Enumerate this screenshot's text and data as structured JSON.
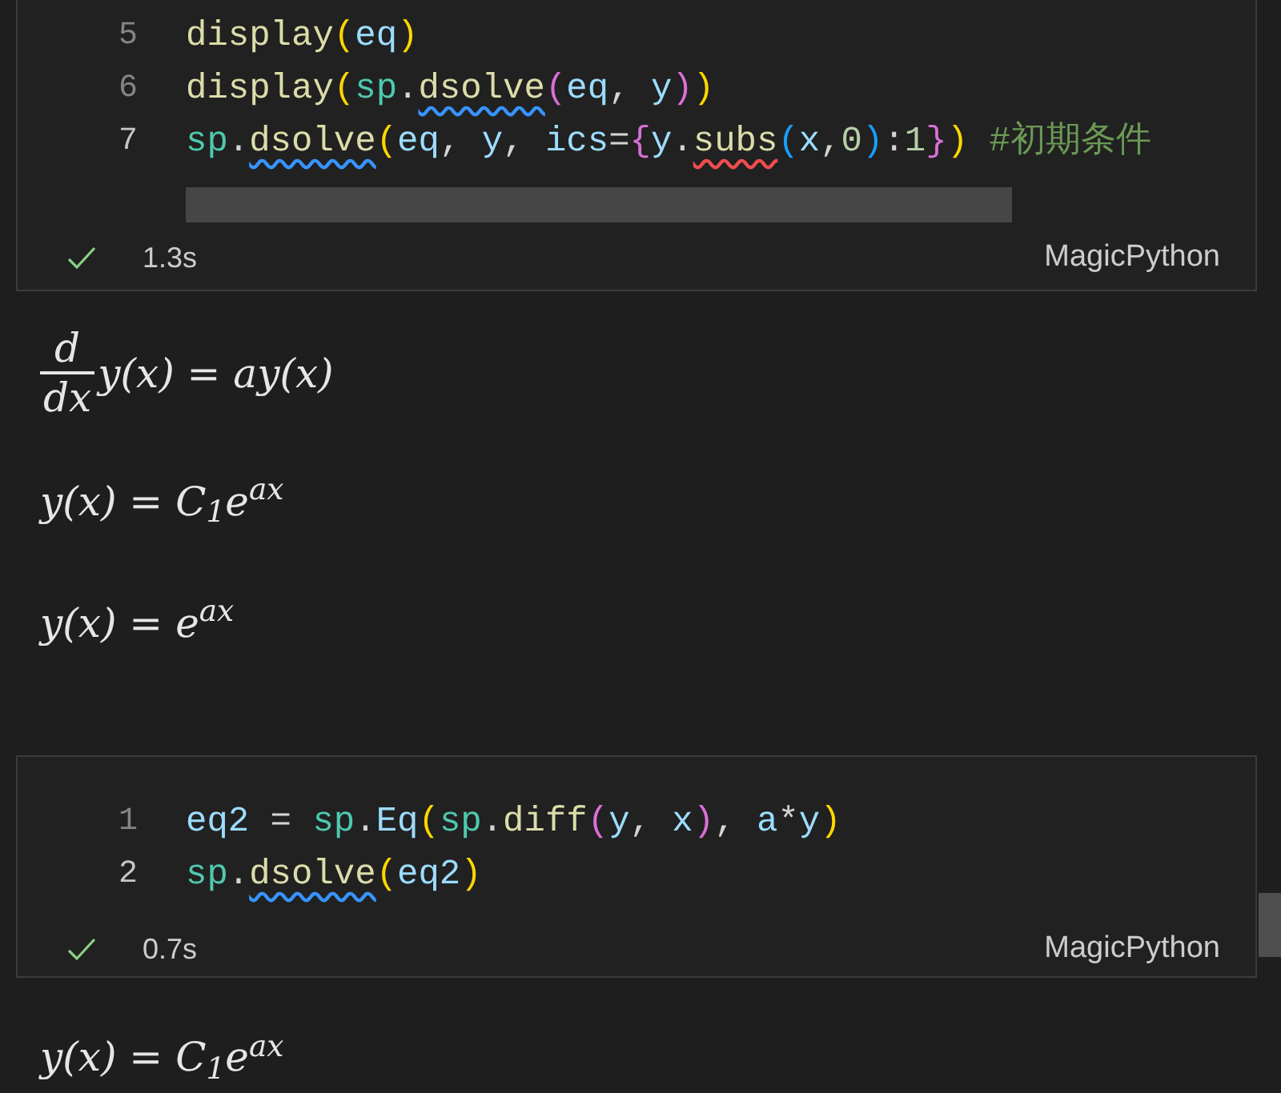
{
  "cells": [
    {
      "lines": [
        {
          "number": "5",
          "current": false,
          "tokens": [
            {
              "text": "display",
              "color": "#dcdcaa"
            },
            {
              "text": "(",
              "color": "#ffd700"
            },
            {
              "text": "eq",
              "color": "#9cdcfe"
            },
            {
              "text": ")",
              "color": "#ffd700"
            }
          ]
        },
        {
          "number": "6",
          "current": false,
          "tokens": [
            {
              "text": "display",
              "color": "#dcdcaa"
            },
            {
              "text": "(",
              "color": "#ffd700"
            },
            {
              "text": "sp",
              "color": "#4ec9b0"
            },
            {
              "text": ".",
              "color": "#d4d4d4"
            },
            {
              "text": "dsolve",
              "color": "#dcdcaa",
              "kind": "warning"
            },
            {
              "text": "(",
              "color": "#da70d6"
            },
            {
              "text": "eq",
              "color": "#9cdcfe"
            },
            {
              "text": ", ",
              "color": "#d4d4d4"
            },
            {
              "text": "y",
              "color": "#9cdcfe"
            },
            {
              "text": ")",
              "color": "#da70d6"
            },
            {
              "text": ")",
              "color": "#ffd700"
            }
          ]
        },
        {
          "number": "7",
          "current": true,
          "tokens": [
            {
              "text": "sp",
              "color": "#4ec9b0"
            },
            {
              "text": ".",
              "color": "#d4d4d4"
            },
            {
              "text": "dsolve",
              "color": "#dcdcaa",
              "kind": "warning"
            },
            {
              "text": "(",
              "color": "#ffd700"
            },
            {
              "text": "eq",
              "color": "#9cdcfe"
            },
            {
              "text": ", ",
              "color": "#d4d4d4"
            },
            {
              "text": "y",
              "color": "#9cdcfe"
            },
            {
              "text": ", ",
              "color": "#d4d4d4"
            },
            {
              "text": "ics",
              "color": "#9cdcfe"
            },
            {
              "text": "=",
              "color": "#d4d4d4"
            },
            {
              "text": "{",
              "color": "#da70d6"
            },
            {
              "text": "y",
              "color": "#9cdcfe"
            },
            {
              "text": ".",
              "color": "#d4d4d4"
            },
            {
              "text": "subs",
              "color": "#dcdcaa",
              "kind": "error"
            },
            {
              "text": "(",
              "color": "#179fff"
            },
            {
              "text": "x",
              "color": "#9cdcfe"
            },
            {
              "text": ",",
              "color": "#d4d4d4"
            },
            {
              "text": "0",
              "color": "#b5cea8"
            },
            {
              "text": ")",
              "color": "#179fff"
            },
            {
              "text": ":",
              "color": "#d4d4d4"
            },
            {
              "text": "1",
              "color": "#b5cea8"
            },
            {
              "text": "}",
              "color": "#da70d6"
            },
            {
              "text": ") ",
              "color": "#ffd700"
            },
            {
              "text": "#初期条件",
              "color": "#6a9955"
            }
          ]
        }
      ],
      "succeeded": true,
      "time": "1.3s",
      "language": "MagicPython",
      "outputs": [
        {
          "parts": [
            {
              "kind": "fraction",
              "numerator": "d",
              "denominator": "dx"
            },
            {
              "kind": "text",
              "text": "y(x) = ay(x)"
            }
          ]
        },
        {
          "parts": [
            {
              "kind": "text",
              "text": "y(x) = C$_{1}$e$^{ax}$"
            }
          ]
        },
        {
          "parts": [
            {
              "kind": "text",
              "text": "y(x) = e$^{ax}$"
            }
          ]
        }
      ]
    },
    {
      "lines": [
        {
          "number": "1",
          "current": false,
          "tokens": [
            {
              "text": "eq2",
              "color": "#9cdcfe"
            },
            {
              "text": " = ",
              "color": "#d4d4d4"
            },
            {
              "text": "sp",
              "color": "#4ec9b0"
            },
            {
              "text": ".",
              "color": "#d4d4d4"
            },
            {
              "text": "Eq",
              "color": "#9cdcfe"
            },
            {
              "text": "(",
              "color": "#ffd700"
            },
            {
              "text": "sp",
              "color": "#4ec9b0"
            },
            {
              "text": ".",
              "color": "#d4d4d4"
            },
            {
              "text": "diff",
              "color": "#dcdcaa"
            },
            {
              "text": "(",
              "color": "#da70d6"
            },
            {
              "text": "y",
              "color": "#9cdcfe"
            },
            {
              "text": ", ",
              "color": "#d4d4d4"
            },
            {
              "text": "x",
              "color": "#9cdcfe"
            },
            {
              "text": ")",
              "color": "#da70d6"
            },
            {
              "text": ", ",
              "color": "#d4d4d4"
            },
            {
              "text": "a",
              "color": "#9cdcfe"
            },
            {
              "text": "*",
              "color": "#d4d4d4"
            },
            {
              "text": "y",
              "color": "#9cdcfe"
            },
            {
              "text": ")",
              "color": "#ffd700"
            }
          ]
        },
        {
          "number": "2",
          "current": true,
          "tokens": [
            {
              "text": "sp",
              "color": "#4ec9b0"
            },
            {
              "text": ".",
              "color": "#d4d4d4"
            },
            {
              "text": "dsolve",
              "color": "#dcdcaa",
              "kind": "warning"
            },
            {
              "text": "(",
              "color": "#ffd700"
            },
            {
              "text": "eq2",
              "color": "#9cdcfe"
            },
            {
              "text": ")",
              "color": "#ffd700"
            }
          ]
        }
      ],
      "succeeded": true,
      "time": "0.7s",
      "language": "MagicPython",
      "outputs": [
        {
          "parts": [
            {
              "kind": "text",
              "text": "y(x) = C$_{1}$e$^{ax}$"
            }
          ]
        }
      ]
    }
  ]
}
